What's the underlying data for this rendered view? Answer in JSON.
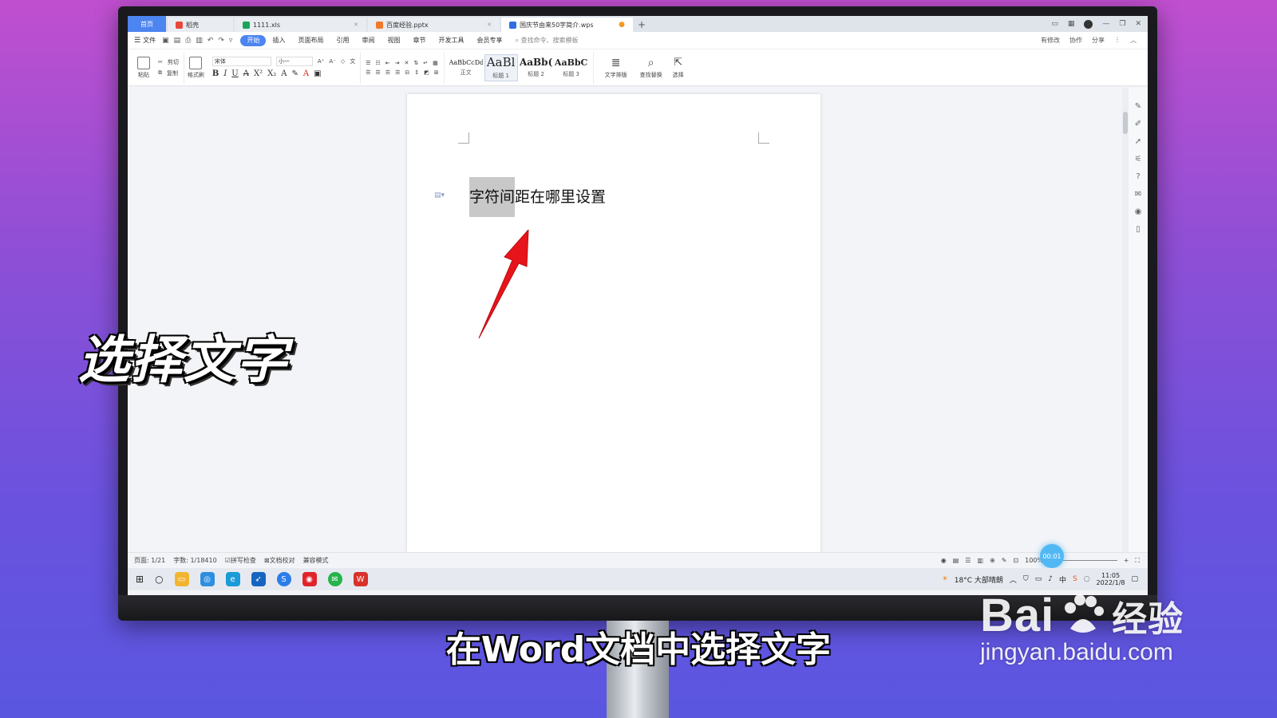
{
  "tabs": [
    {
      "label": "首页",
      "type": "home"
    },
    {
      "label": "稻壳",
      "type": "normal",
      "color": "#e8483a"
    },
    {
      "label": "1111.xls",
      "type": "wide",
      "color": "#1aa35a"
    },
    {
      "label": "百度经验.pptx",
      "type": "wide",
      "color": "#f07a2a"
    },
    {
      "label": "国庆节由来50字简介.wps",
      "type": "active",
      "color": "#2f6de1"
    }
  ],
  "menu": {
    "file": "文件",
    "items": [
      "开始",
      "插入",
      "页面布局",
      "引用",
      "审阅",
      "视图",
      "章节",
      "开发工具",
      "会员专享"
    ],
    "active": "开始",
    "search": "查找命令、搜索模板",
    "right": [
      "有修改",
      "协作",
      "分享"
    ]
  },
  "ribbon": {
    "paste": "粘贴",
    "cut": "剪切",
    "copy": "复制",
    "format_painter": "格式刷",
    "font": "宋体",
    "size": "小一",
    "styles": [
      {
        "sample": "AaBbCcDd",
        "name": "正文"
      },
      {
        "sample": "AaBl",
        "name": "标题 1"
      },
      {
        "sample": "AaBb(",
        "name": "标题 2"
      },
      {
        "sample": "AaBbC",
        "name": "标题 3"
      }
    ],
    "text_layout": "文字排版",
    "find_replace": "查找替换",
    "select": "选择"
  },
  "document": {
    "heading_selected": "字符间",
    "heading_rest": "距在哪里设置"
  },
  "status": {
    "page": "页面: 1/21",
    "words": "字数: 1/18410",
    "spell": "拼写检查",
    "proof": "文档校对",
    "compat": "兼容模式",
    "zoom": "100%",
    "timer": "00:01"
  },
  "taskbar": {
    "weather": "18°C 大部晴朗",
    "time": "11:05",
    "date": "2022/1/8"
  },
  "overlay": {
    "caption": "选择文字",
    "subtitle": "在Word文档中选择文字",
    "watermark_brand": "Bai",
    "watermark_brand2": "经验",
    "watermark_url": "jingyan.baidu.com"
  },
  "colors": {
    "accent": "#4c84f0",
    "arrow": "#e8141b",
    "selection": "#c8c8c8"
  }
}
